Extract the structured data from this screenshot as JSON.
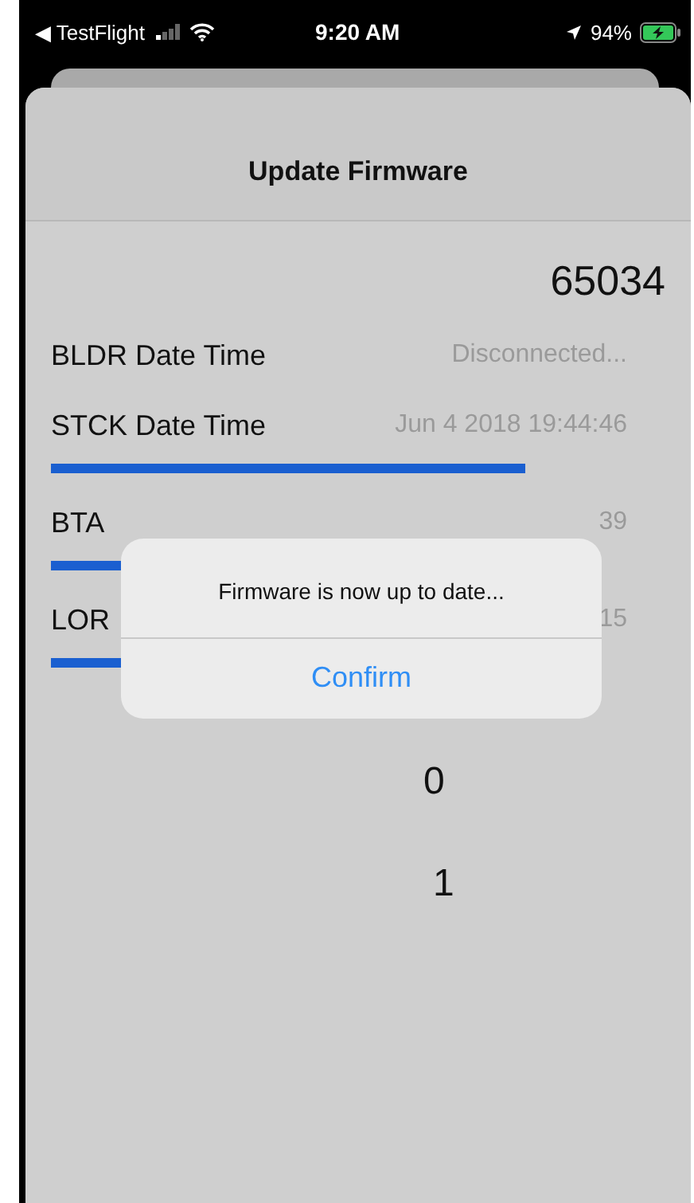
{
  "status_bar": {
    "back_label": "◀ TestFlight",
    "time": "9:20 AM",
    "battery": "94%"
  },
  "nav": {
    "title": "Update Firmware"
  },
  "counter": "65034",
  "rows": [
    {
      "label": "BLDR Date Time",
      "value": "Disconnected..."
    },
    {
      "label": "STCK Date Time",
      "value": "Jun  4 2018 19:44:46"
    },
    {
      "label": "BTA",
      "value": "39"
    },
    {
      "label": "LOR",
      "value": "15"
    }
  ],
  "numbers": [
    "0",
    "1"
  ],
  "alert": {
    "message": "Firmware is now up to date...",
    "button": "Confirm"
  }
}
